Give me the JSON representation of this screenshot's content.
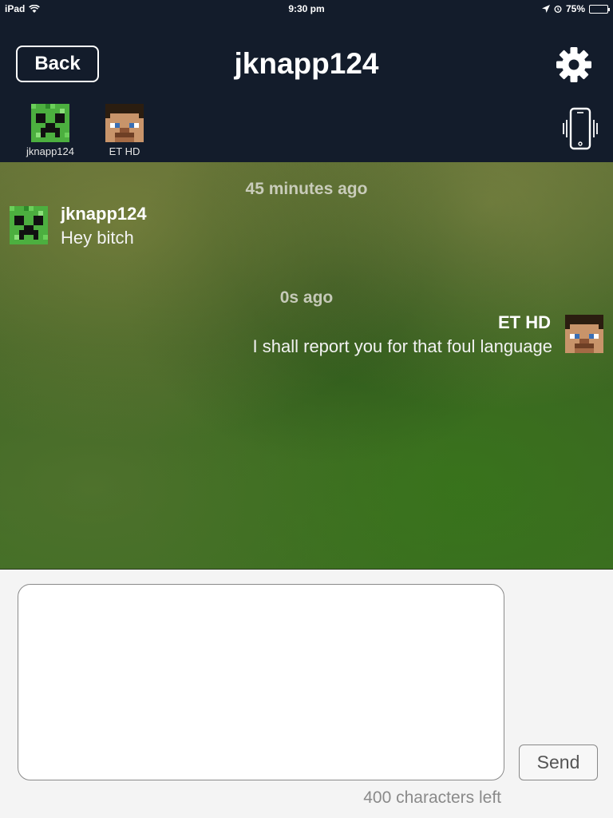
{
  "status_bar": {
    "device": "iPad",
    "time": "9:30 pm",
    "battery": "75%",
    "battery_fraction": 0.75
  },
  "header": {
    "back_label": "Back",
    "title": "jknapp124"
  },
  "participants": [
    {
      "name": "jknapp124",
      "avatar": "creeper-avatar"
    },
    {
      "name": "ET HD",
      "avatar": "steve-avatar"
    }
  ],
  "messages": [
    {
      "timestamp": "45 minutes ago",
      "sender": "jknapp124",
      "text": "Hey bitch",
      "side": "left"
    },
    {
      "timestamp": "0s ago",
      "sender": "ET HD",
      "text": "I shall report you for that foul language",
      "side": "right"
    }
  ],
  "compose": {
    "value": "",
    "send_label": "Send",
    "chars_left": "400 characters left"
  },
  "colors": {
    "header_bg": "#131c2b",
    "chat_bg": "#3d6124",
    "compose_bg": "#f4f4f4"
  }
}
